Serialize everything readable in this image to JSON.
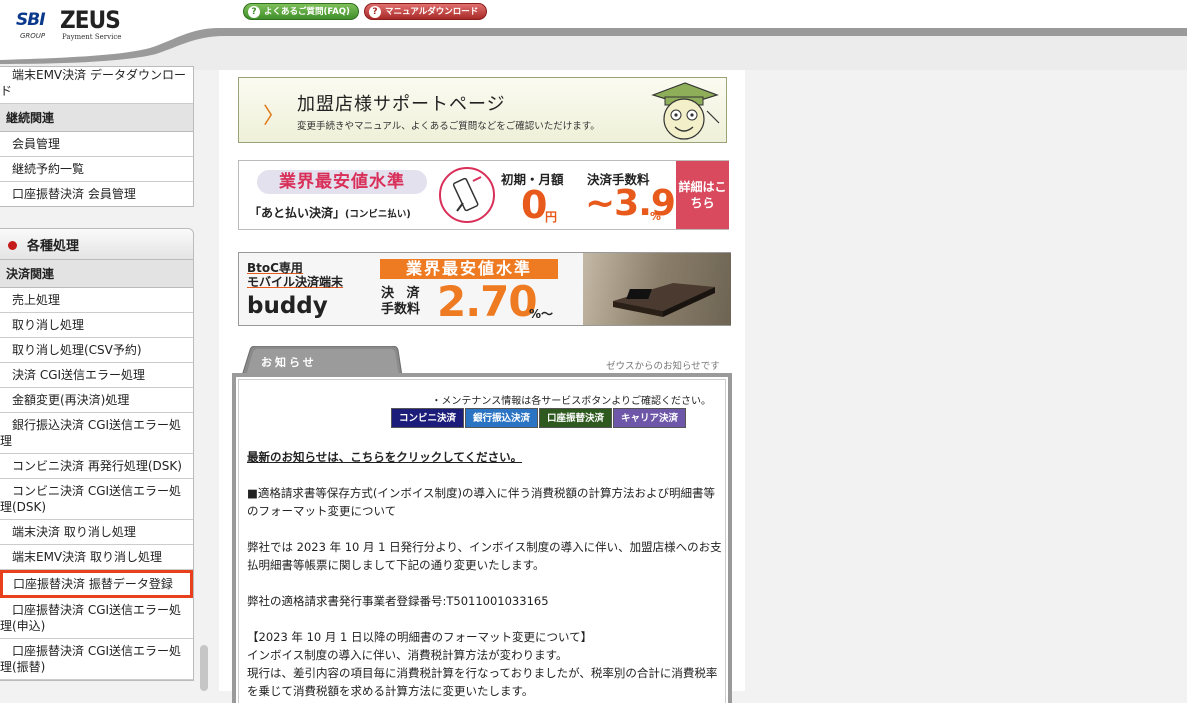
{
  "header": {
    "logo": {
      "sbi": "SBI",
      "zeus": "ZEUS",
      "group": "GROUP",
      "payment": "Payment Service"
    },
    "faq_button": "よくあるご質問(FAQ)",
    "manual_button": "マニュアルダウンロード"
  },
  "sidebar": {
    "panel1": {
      "top_item": "端末EMV決済 データダウンロード",
      "head": "継続関連",
      "items": [
        "会員管理",
        "継続予約一覧",
        "口座振替決済 会員管理"
      ]
    },
    "panel2": {
      "section": "各種処理",
      "head": "決済関連",
      "items": [
        "売上処理",
        "取り消し処理",
        "取り消し処理(CSV予約)",
        "決済 CGI送信エラー処理",
        "金額変更(再決済)処理",
        "銀行振込決済 CGI送信エラー処理",
        "コンビニ決済 再発行処理(DSK)",
        "コンビニ決済 CGI送信エラー処理(DSK)",
        "端末決済 取り消し処理",
        "端末EMV決済 取り消し処理",
        "口座振替決済 振替データ登録",
        "口座振替決済 CGI送信エラー処理(申込)",
        "口座振替決済 CGI送信エラー処理(振替)"
      ]
    }
  },
  "banners": {
    "support": {
      "title": "加盟店様サポートページ",
      "sub": "変更手続きやマニュアル、よくあるご質問などをご確認いただけます。"
    },
    "konbini": {
      "lowest": "業界最安値水準",
      "atobarai": "「あと払い決済」",
      "atobarai_small": "(コンビニ払い)",
      "label_initial": "初期・月額",
      "label_fee": "決済手数料",
      "zero": "0",
      "yen": "円",
      "fee": "~3.9",
      "pct": "%",
      "detail": "詳細はこちら"
    },
    "buddy": {
      "btoc1": "BtoC専用",
      "btoc2": "モバイル決済端末",
      "name": "buddy",
      "lowest": "業界最安値水準",
      "kessai1": "決 済",
      "kessai2": "手数料",
      "rate": "2.70",
      "pct": "%～"
    }
  },
  "news": {
    "tab": "お知らせ",
    "caption": "ゼウスからのお知らせです",
    "maintenance": "・メンテナンス情報は各サービスボタンよりご確認ください。",
    "services": [
      "コンビニ決済",
      "銀行振込決済",
      "口座振替決済",
      "キャリア決済"
    ],
    "latest_link": "最新のお知らせは、こちらをクリックしてください。",
    "para1": "■適格請求書等保存方式(インボイス制度)の導入に伴う消費税額の計算方法および明細書等のフォーマット変更について",
    "para2": "弊社では 2023 年 10 月 1 日発行分より、インボイス制度の導入に伴い、加盟店様へのお支払明細書等帳票に関しまして下記の通り変更いたします。",
    "para3": "弊社の適格請求書発行事業者登録番号:T5011001033165",
    "para4_l1": "【2023 年 10 月 1 日以降の明細書のフォーマット変更について】",
    "para4_l2": "インボイス制度の導入に伴い、消費税計算方法が変わります。",
    "para4_l3": "現行は、差引内容の項目毎に消費税計算を行なっておりましたが、税率別の合計に消費税率を乗じて消費税額を求める計算方法に変更いたします。"
  }
}
